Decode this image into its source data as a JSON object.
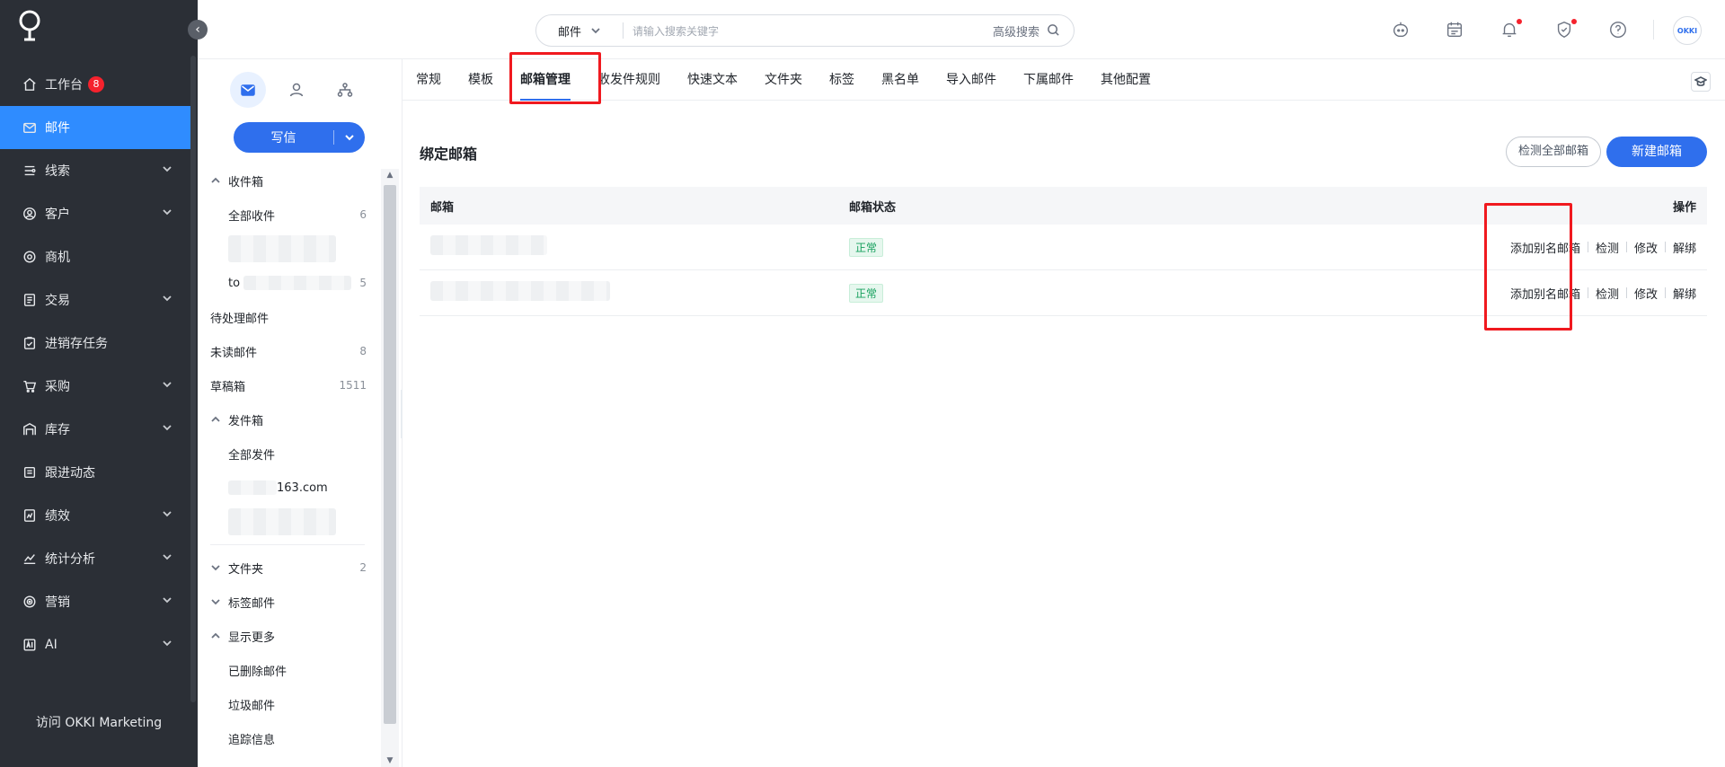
{
  "sidebar": {
    "items": [
      {
        "label": "工作台",
        "icon": "home-icon",
        "badge": "8",
        "expandable": false
      },
      {
        "label": "邮件",
        "icon": "mail-icon",
        "active": true,
        "expandable": false
      },
      {
        "label": "线索",
        "icon": "leads-icon",
        "expandable": true
      },
      {
        "label": "客户",
        "icon": "customer-icon",
        "expandable": true
      },
      {
        "label": "商机",
        "icon": "opportunity-icon",
        "expandable": false
      },
      {
        "label": "交易",
        "icon": "trade-icon",
        "expandable": true
      },
      {
        "label": "进销存任务",
        "icon": "task-icon",
        "expandable": false
      },
      {
        "label": "采购",
        "icon": "cart-icon",
        "expandable": true
      },
      {
        "label": "库存",
        "icon": "warehouse-icon",
        "expandable": true
      },
      {
        "label": "跟进动态",
        "icon": "activity-icon",
        "expandable": false
      },
      {
        "label": "绩效",
        "icon": "performance-icon",
        "expandable": true
      },
      {
        "label": "统计分析",
        "icon": "chart-icon",
        "expandable": true
      },
      {
        "label": "营销",
        "icon": "marketing-icon",
        "expandable": true
      },
      {
        "label": "AI",
        "icon": "ai-icon",
        "expandable": true
      }
    ],
    "footer": "访问 OKKI Marketing"
  },
  "header": {
    "search": {
      "scope": "邮件",
      "placeholder": "请输入搜索关键字",
      "advanced": "高级搜索"
    },
    "avatar": "OKKI"
  },
  "mailpanel": {
    "write_label": "写信",
    "folders": [
      {
        "label": "收件箱",
        "toggle": "up",
        "level": 0
      },
      {
        "label": "全部收件",
        "count": "6",
        "level": 1
      },
      {
        "label": "",
        "level": 1,
        "redacted": true
      },
      {
        "label": "to",
        "count": "5",
        "level": 1,
        "redacted_tail": true
      },
      {
        "label": "待处理邮件",
        "level": -1
      },
      {
        "label": "未读邮件",
        "count": "8",
        "level": -1
      },
      {
        "label": "草稿箱",
        "count": "1511",
        "level": -1
      },
      {
        "label": "发件箱",
        "toggle": "up",
        "level": 0
      },
      {
        "label": "全部发件",
        "level": 1
      },
      {
        "label": "163.com",
        "level": 1,
        "redacted_head": true
      },
      {
        "label": "",
        "level": 1,
        "redacted": true
      }
    ],
    "folders2": [
      {
        "label": "文件夹",
        "toggle": "down",
        "count": "2",
        "level": 0
      },
      {
        "label": "标签邮件",
        "toggle": "down",
        "level": 0
      },
      {
        "label": "显示更多",
        "toggle": "up",
        "level": 0
      },
      {
        "label": "已删除邮件",
        "level": 1
      },
      {
        "label": "垃圾邮件",
        "level": 1
      },
      {
        "label": "追踪信息",
        "level": 1
      }
    ]
  },
  "main": {
    "tabs": [
      "常规",
      "模板",
      "邮箱管理",
      "收发件规则",
      "快速文本",
      "文件夹",
      "标签",
      "黑名单",
      "导入邮件",
      "下属邮件",
      "其他配置"
    ],
    "active_tab": "邮箱管理",
    "section_title": "绑定邮箱",
    "check_all_label": "检测全部邮箱",
    "new_mailbox_label": "新建邮箱",
    "table": {
      "headers": {
        "mailbox": "邮箱",
        "status": "邮箱状态",
        "ops": "操作"
      },
      "rows": [
        {
          "mailbox": "",
          "status": "正常",
          "ops": [
            "添加别名邮箱",
            "检测",
            "修改",
            "解绑"
          ]
        },
        {
          "mailbox": "",
          "status": "正常",
          "ops": [
            "添加别名邮箱",
            "检测",
            "修改",
            "解绑"
          ]
        }
      ]
    }
  },
  "colors": {
    "accent": "#2f6fed",
    "sidebar_bg": "#2b2f36",
    "active_nav": "#2f8cff",
    "highlight": "#f0191f",
    "status_green": "#16a05d"
  }
}
